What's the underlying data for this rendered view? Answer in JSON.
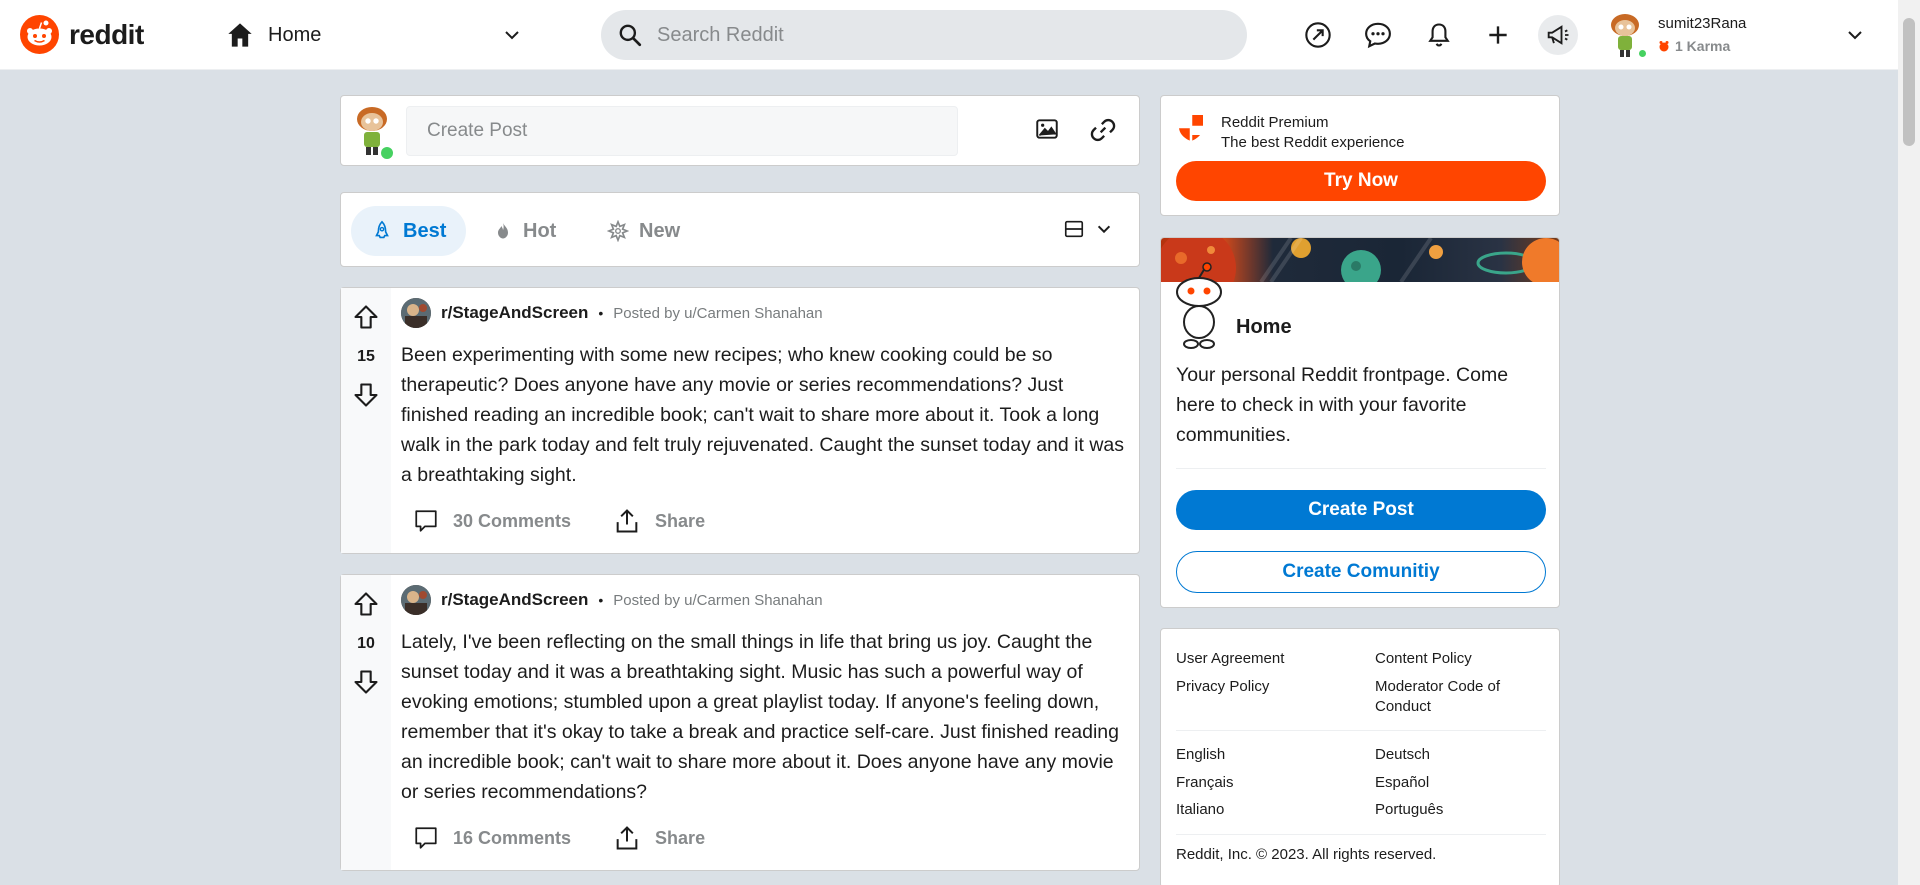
{
  "header": {
    "logo_text": "reddit",
    "feed_label": "Home",
    "search_placeholder": "Search Reddit",
    "user": {
      "name": "sumit23Rana",
      "karma": "1 Karma"
    },
    "icons": [
      "popular-icon",
      "chat-icon",
      "notifications-icon",
      "plus-icon",
      "advertise-icon"
    ]
  },
  "create_post": {
    "placeholder": "Create Post"
  },
  "sort": {
    "tabs": [
      {
        "label": "Best",
        "icon": "rocket-icon",
        "active": true
      },
      {
        "label": "Hot",
        "icon": "flame-icon",
        "active": false
      },
      {
        "label": "New",
        "icon": "sparkle-icon",
        "active": false
      }
    ]
  },
  "posts": [
    {
      "subreddit": "r/StageAndScreen",
      "posted_by": "Posted by u/Carmen Shanahan",
      "votes": "15",
      "body": "Been experimenting with some new recipes; who knew cooking could be so therapeutic? Does anyone have any movie or series recommendations? Just finished reading an incredible book; can't wait to share more about it. Took a long walk in the park today and felt truly rejuvenated. Caught the sunset today and it was a breathtaking sight.",
      "comments": "30 Comments",
      "share": "Share"
    },
    {
      "subreddit": "r/StageAndScreen",
      "posted_by": "Posted by u/Carmen Shanahan",
      "votes": "10",
      "body": "Lately, I've been reflecting on the small things in life that bring us joy. Caught the sunset today and it was a breathtaking sight. Music has such a powerful way of evoking emotions; stumbled upon a great playlist today. If anyone's feeling down, remember that it's okay to take a break and practice self-care. Just finished reading an incredible book; can't wait to share more about it. Does anyone have any movie or series recommendations?",
      "comments": "16 Comments",
      "share": "Share"
    }
  ],
  "premium": {
    "title": "Reddit Premium",
    "subtitle": "The best Reddit experience",
    "button": "Try Now"
  },
  "home_card": {
    "title": "Home",
    "description": "Your personal Reddit frontpage. Come here to check in with your favorite communities.",
    "create_post": "Create Post",
    "create_community": "Create Comunitiy"
  },
  "footer": {
    "links": [
      "User Agreement",
      "Content Policy",
      "Privacy Policy",
      "Moderator Code of Conduct"
    ],
    "languages": [
      "English",
      "Deutsch",
      "Français",
      "Español",
      "Italiano",
      "Português"
    ],
    "copyright": "Reddit, Inc. © 2023. All rights reserved."
  },
  "colors": {
    "brand": "#ff4500",
    "accent": "#0079d3",
    "background": "#dae0e6"
  }
}
